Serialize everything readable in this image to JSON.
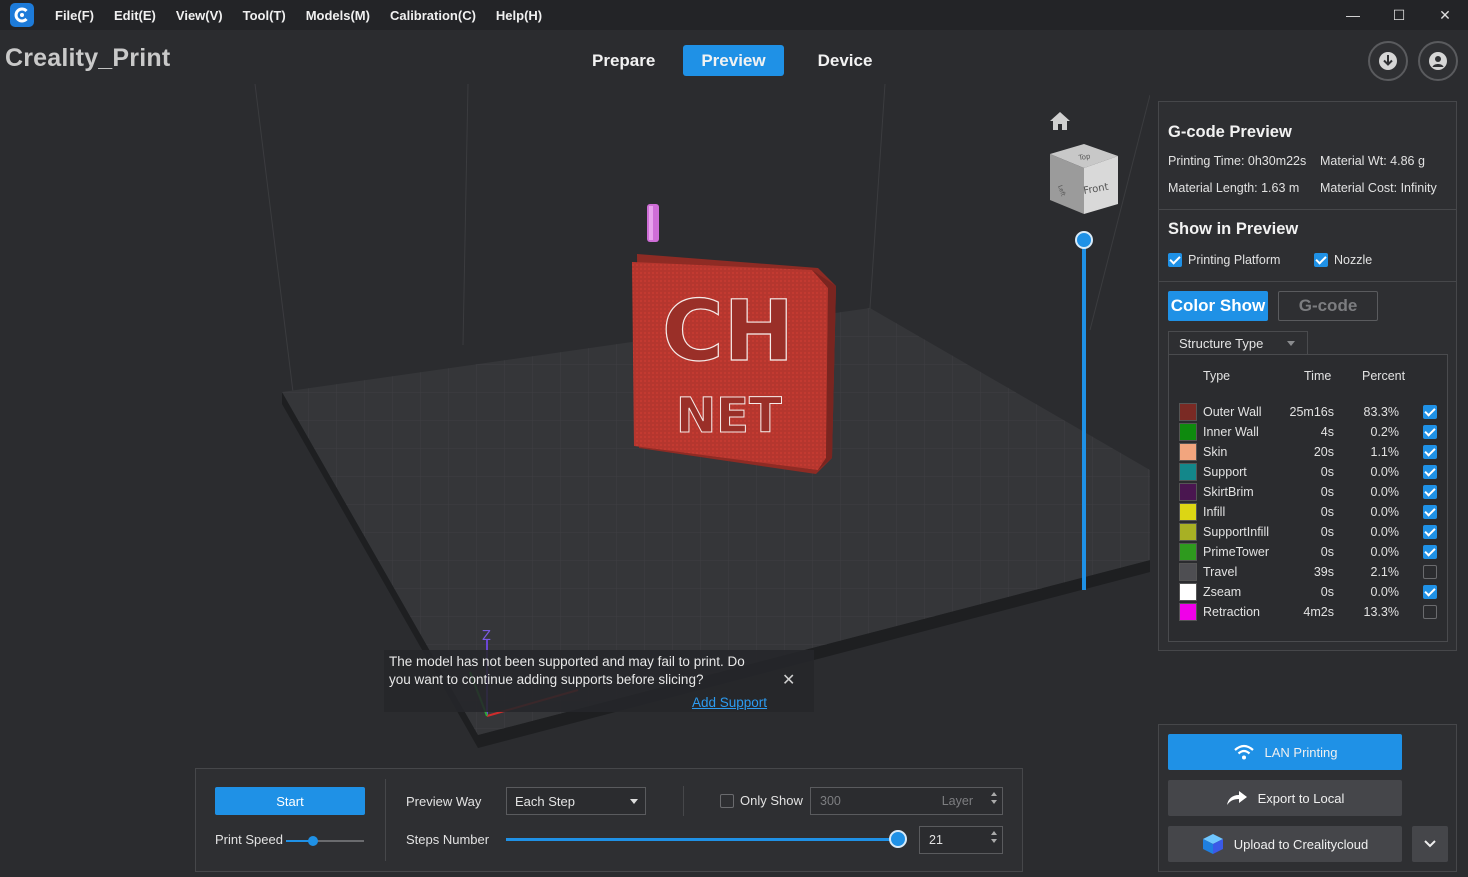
{
  "menu": [
    "File(F)",
    "Edit(E)",
    "View(V)",
    "Tool(T)",
    "Models(M)",
    "Calibration(C)",
    "Help(H)"
  ],
  "window_controls": {
    "minimize": "—",
    "maximize": "☐",
    "close": "✕"
  },
  "app_title": "Creality_Print",
  "mode_tabs": [
    {
      "label": "Prepare",
      "active": false
    },
    {
      "label": "Preview",
      "active": true
    },
    {
      "label": "Device",
      "active": false
    }
  ],
  "header_icons": [
    "download-icon",
    "user-icon"
  ],
  "viewcube": {
    "top": "Top",
    "front": "Front",
    "left": "Left"
  },
  "model_text": {
    "line1": "CH",
    "line2": "NET"
  },
  "layer_slider_value": 1.0,
  "toast": {
    "message": "The model has not been supported and may fail to print. Do you want to continue adding supports before slicing?",
    "close": "✕",
    "link": "Add Support"
  },
  "gcode": {
    "title": "G-code Preview",
    "printing_time": "Printing Time: 0h30m22s",
    "material_wt": "Material Wt: 4.86 g",
    "material_length": "Material Length: 1.63 m",
    "material_cost": "Material Cost: Infinity"
  },
  "show_in_preview": {
    "title": "Show in Preview",
    "printing_platform": {
      "label": "Printing Platform",
      "checked": true
    },
    "nozzle": {
      "label": "Nozzle",
      "checked": true
    }
  },
  "view_mode": {
    "color_show": "Color Show",
    "gcode": "G-code"
  },
  "structure_type": "Structure Type",
  "legend_headers": {
    "type": "Type",
    "time": "Time",
    "percent": "Percent"
  },
  "legend": [
    {
      "name": "Outer Wall",
      "time": "25m16s",
      "percent": "83.3%",
      "color": "#7a2a24",
      "checked": true
    },
    {
      "name": "Inner Wall",
      "time": "4s",
      "percent": "0.2%",
      "color": "#0e8a0e",
      "checked": true
    },
    {
      "name": "Skin",
      "time": "20s",
      "percent": "1.1%",
      "color": "#f2a57e",
      "checked": true
    },
    {
      "name": "Support",
      "time": "0s",
      "percent": "0.0%",
      "color": "#13878a",
      "checked": true
    },
    {
      "name": "SkirtBrim",
      "time": "0s",
      "percent": "0.0%",
      "color": "#4a1650",
      "checked": true
    },
    {
      "name": "Infill",
      "time": "0s",
      "percent": "0.0%",
      "color": "#dcd614",
      "checked": true
    },
    {
      "name": "SupportInfill",
      "time": "0s",
      "percent": "0.0%",
      "color": "#a8b024",
      "checked": true
    },
    {
      "name": "PrimeTower",
      "time": "0s",
      "percent": "0.0%",
      "color": "#2e9a1e",
      "checked": true
    },
    {
      "name": "Travel",
      "time": "39s",
      "percent": "2.1%",
      "color": "#4e4e52",
      "checked": false
    },
    {
      "name": "Zseam",
      "time": "0s",
      "percent": "0.0%",
      "color": "#ffffff",
      "checked": true
    },
    {
      "name": "Retraction",
      "time": "4m2s",
      "percent": "13.3%",
      "color": "#f000e8",
      "checked": false
    }
  ],
  "export": {
    "lan": "LAN Printing",
    "local": "Export to Local",
    "cloud": "Upload to Crealitycloud"
  },
  "bottom": {
    "start": "Start",
    "print_speed": "Print Speed",
    "print_speed_value": 0.35,
    "preview_way": "Preview Way",
    "preview_way_value": "Each Step",
    "only_show": "Only Show",
    "only_show_checked": false,
    "layer_value": "300",
    "layer_unit": "Layer",
    "steps_number": "Steps Number",
    "steps_slider_value": 1.0,
    "steps_value": "21"
  },
  "axis_label_z": "Z"
}
